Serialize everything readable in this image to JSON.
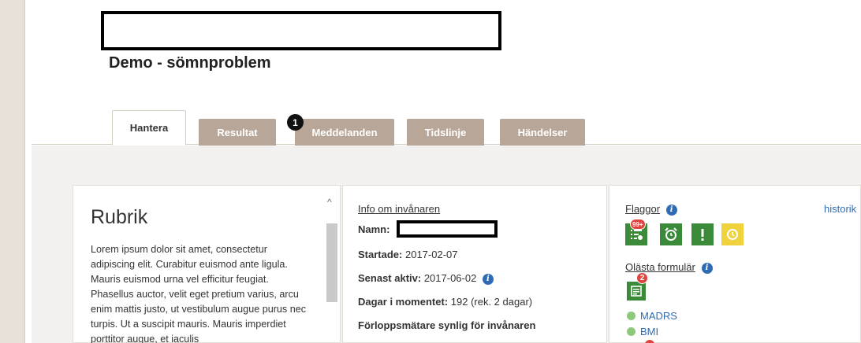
{
  "header": {
    "title": "Demo - sömnproblem"
  },
  "tabs": [
    {
      "label": "Hantera",
      "active": true
    },
    {
      "label": "Resultat",
      "active": false
    },
    {
      "label": "Meddelanden",
      "active": false,
      "badge": "1"
    },
    {
      "label": "Tidslinje",
      "active": false
    },
    {
      "label": "Händelser",
      "active": false
    }
  ],
  "left_panel": {
    "heading": "Rubrik",
    "body": "Lorem ipsum dolor sit amet, consectetur adipiscing elit. Curabitur euismod ante ligula. Mauris euismod urna vel efficitur feugiat. Phasellus auctor, velit eget pretium varius, arcu enim mattis justo, ut vestibulum augue purus nec turpis. Ut a suscipit mauris. Mauris imperdiet porttitor augue, et iaculis",
    "scroll_up": "^"
  },
  "info_panel": {
    "link": "Info om invånaren",
    "name_label": "Namn:",
    "started_label": "Startade:",
    "started_value": "2017-02-07",
    "last_active_label": "Senast aktiv:",
    "last_active_value": "2017-06-02",
    "days_label": "Dagar i momentet:",
    "days_value": "192 (rek. 2 dagar)",
    "progress_label": "Förloppsmätare synlig för invånaren",
    "info_icon": "i"
  },
  "flags_panel": {
    "flags_label": "Flaggor",
    "historik": "historik",
    "flag_count_badge": "99+",
    "flags": [
      {
        "icon": "list-alert-icon",
        "color": "#3a8a3a"
      },
      {
        "icon": "alarm-clock-icon",
        "color": "#3a8a3a"
      },
      {
        "icon": "exclamation-icon",
        "color": "#3a8a3a"
      },
      {
        "icon": "history-icon",
        "color": "#f0d23c"
      }
    ],
    "unread_label": "Olästa formulär",
    "unread_badge": "2",
    "surveys": [
      "MADRS",
      "BMI"
    ]
  },
  "colors": {
    "tab_inactive": "#b8a798",
    "accent_green": "#3a8a3a",
    "badge_red": "#e0443f",
    "link_blue": "#2f6bb2"
  }
}
